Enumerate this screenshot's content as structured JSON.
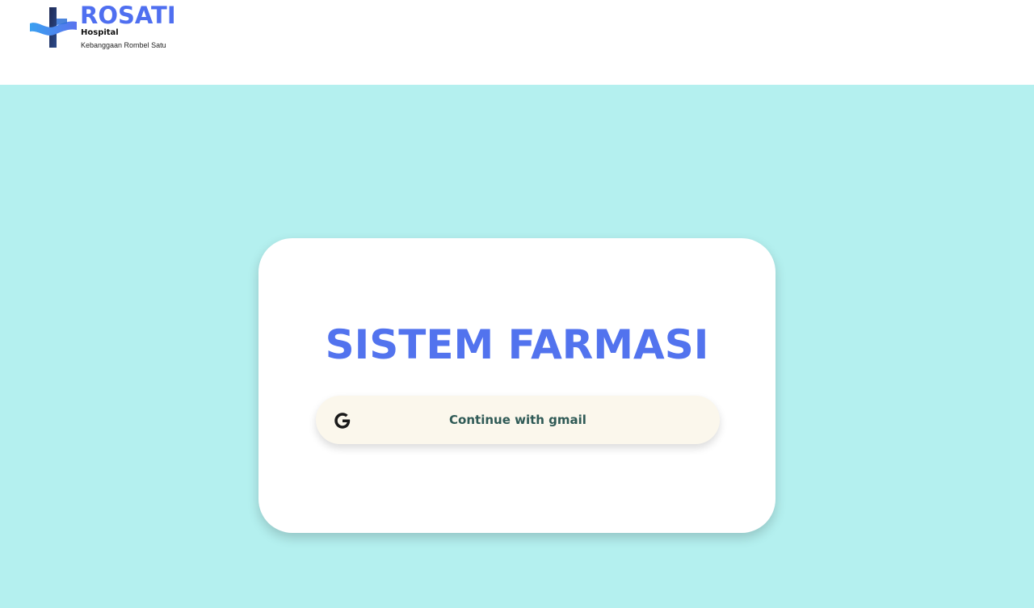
{
  "header": {
    "logo": {
      "icon": "medical-cross-icon",
      "title": "ROSATI",
      "subtitle": "Hospital",
      "tagline": "Kebanggaan Rombel Satu"
    }
  },
  "login_card": {
    "title": "SISTEM FARMASI",
    "gmail_button": {
      "icon": "google-g-icon",
      "label": "Continue with gmail"
    }
  },
  "colors": {
    "header_bg": "#ffffff",
    "page_bg": "#b4f0ef",
    "card_bg": "#ffffff",
    "title_color": "#5273ee",
    "button_bg": "#fbf7ec",
    "button_text": "#2f5a56",
    "logo_blue": "#4f6ff0",
    "logo_navy": "#1f2a55"
  }
}
